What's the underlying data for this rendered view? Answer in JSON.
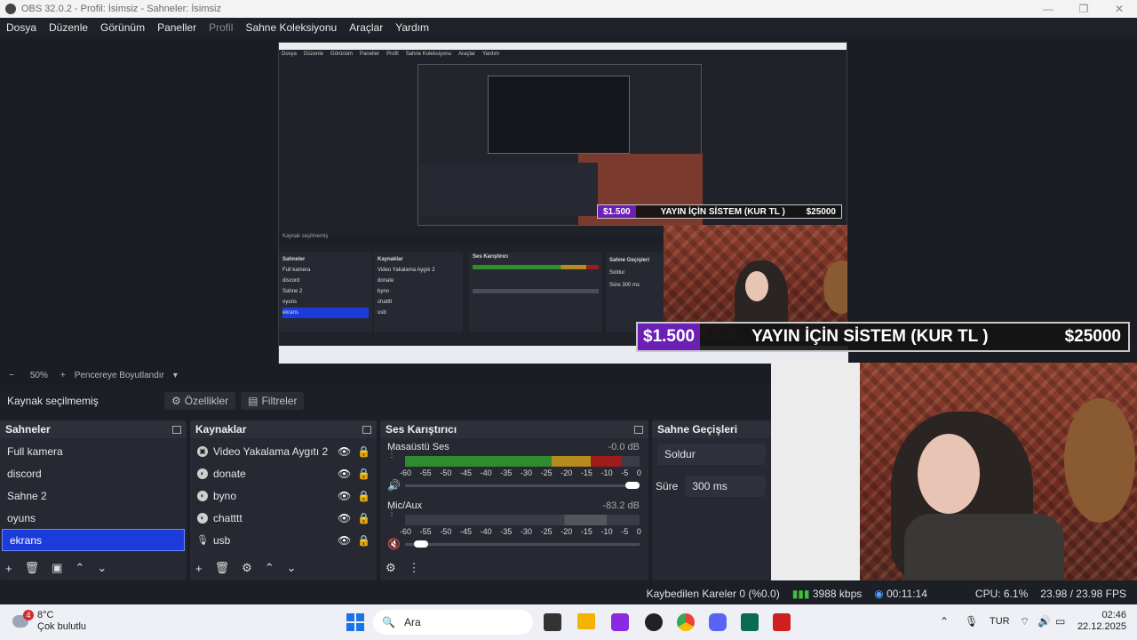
{
  "window": {
    "title": "OBS 32.0.2 - Profil: İsimsiz - Sahneler: İsimsiz"
  },
  "menu": {
    "items": [
      "Dosya",
      "Düzenle",
      "Görünüm",
      "Paneller",
      "Profil",
      "Sahne Koleksiyonu",
      "Araçlar",
      "Yardım"
    ]
  },
  "overlay": {
    "amount_left": "$1.500",
    "text": "YAYIN İÇİN SİSTEM (KUR TL )",
    "amount_right": "$25000"
  },
  "zoom": {
    "minus": "−",
    "value": "50%",
    "plus": "+",
    "fit": "Pencereye Boyutlandır"
  },
  "source_bar": {
    "status": "Kaynak seçilmemiş",
    "properties": "Özellikler",
    "filters": "Filtreler"
  },
  "scenes": {
    "title": "Sahneler",
    "items": [
      "Full kamera",
      "discord",
      "Sahne 2",
      "oyuns",
      "ekrans"
    ],
    "selected": "ekrans"
  },
  "sources": {
    "title": "Kaynaklar",
    "items": [
      "Video Yakalama Aygıtı 2",
      "donate",
      "byno",
      "chatttt",
      "usb"
    ]
  },
  "mixer": {
    "title": "Ses Karıştırıcı",
    "channels": [
      {
        "name": "Masaüstü Ses",
        "db": "-0.0 dB",
        "level": 0.92
      },
      {
        "name": "Mic/Aux",
        "db": "-83.2 dB",
        "level": 0.0
      }
    ],
    "scale": [
      "-60",
      "-55",
      "-50",
      "-45",
      "-40",
      "-35",
      "-30",
      "-25",
      "-20",
      "-15",
      "-10",
      "-5",
      "0"
    ]
  },
  "transitions": {
    "title": "Sahne Geçişleri",
    "type": "Soldur",
    "duration_label": "Süre",
    "duration": "300 ms"
  },
  "status": {
    "dropped": "Kaybedilen Kareler 0 (%0.0)",
    "bitrate": "3988 kbps",
    "time": "00:11:14",
    "cpu": "CPU: 6.1%",
    "fps": "23.98 / 23.98 FPS"
  },
  "taskbar": {
    "weather_temp": "8°C",
    "weather_desc": "Çok bulutlu",
    "weather_badge": "4",
    "search": "Ara",
    "lang": "TUR",
    "clock_time": "02:46",
    "clock_date": "22.12.2025"
  }
}
